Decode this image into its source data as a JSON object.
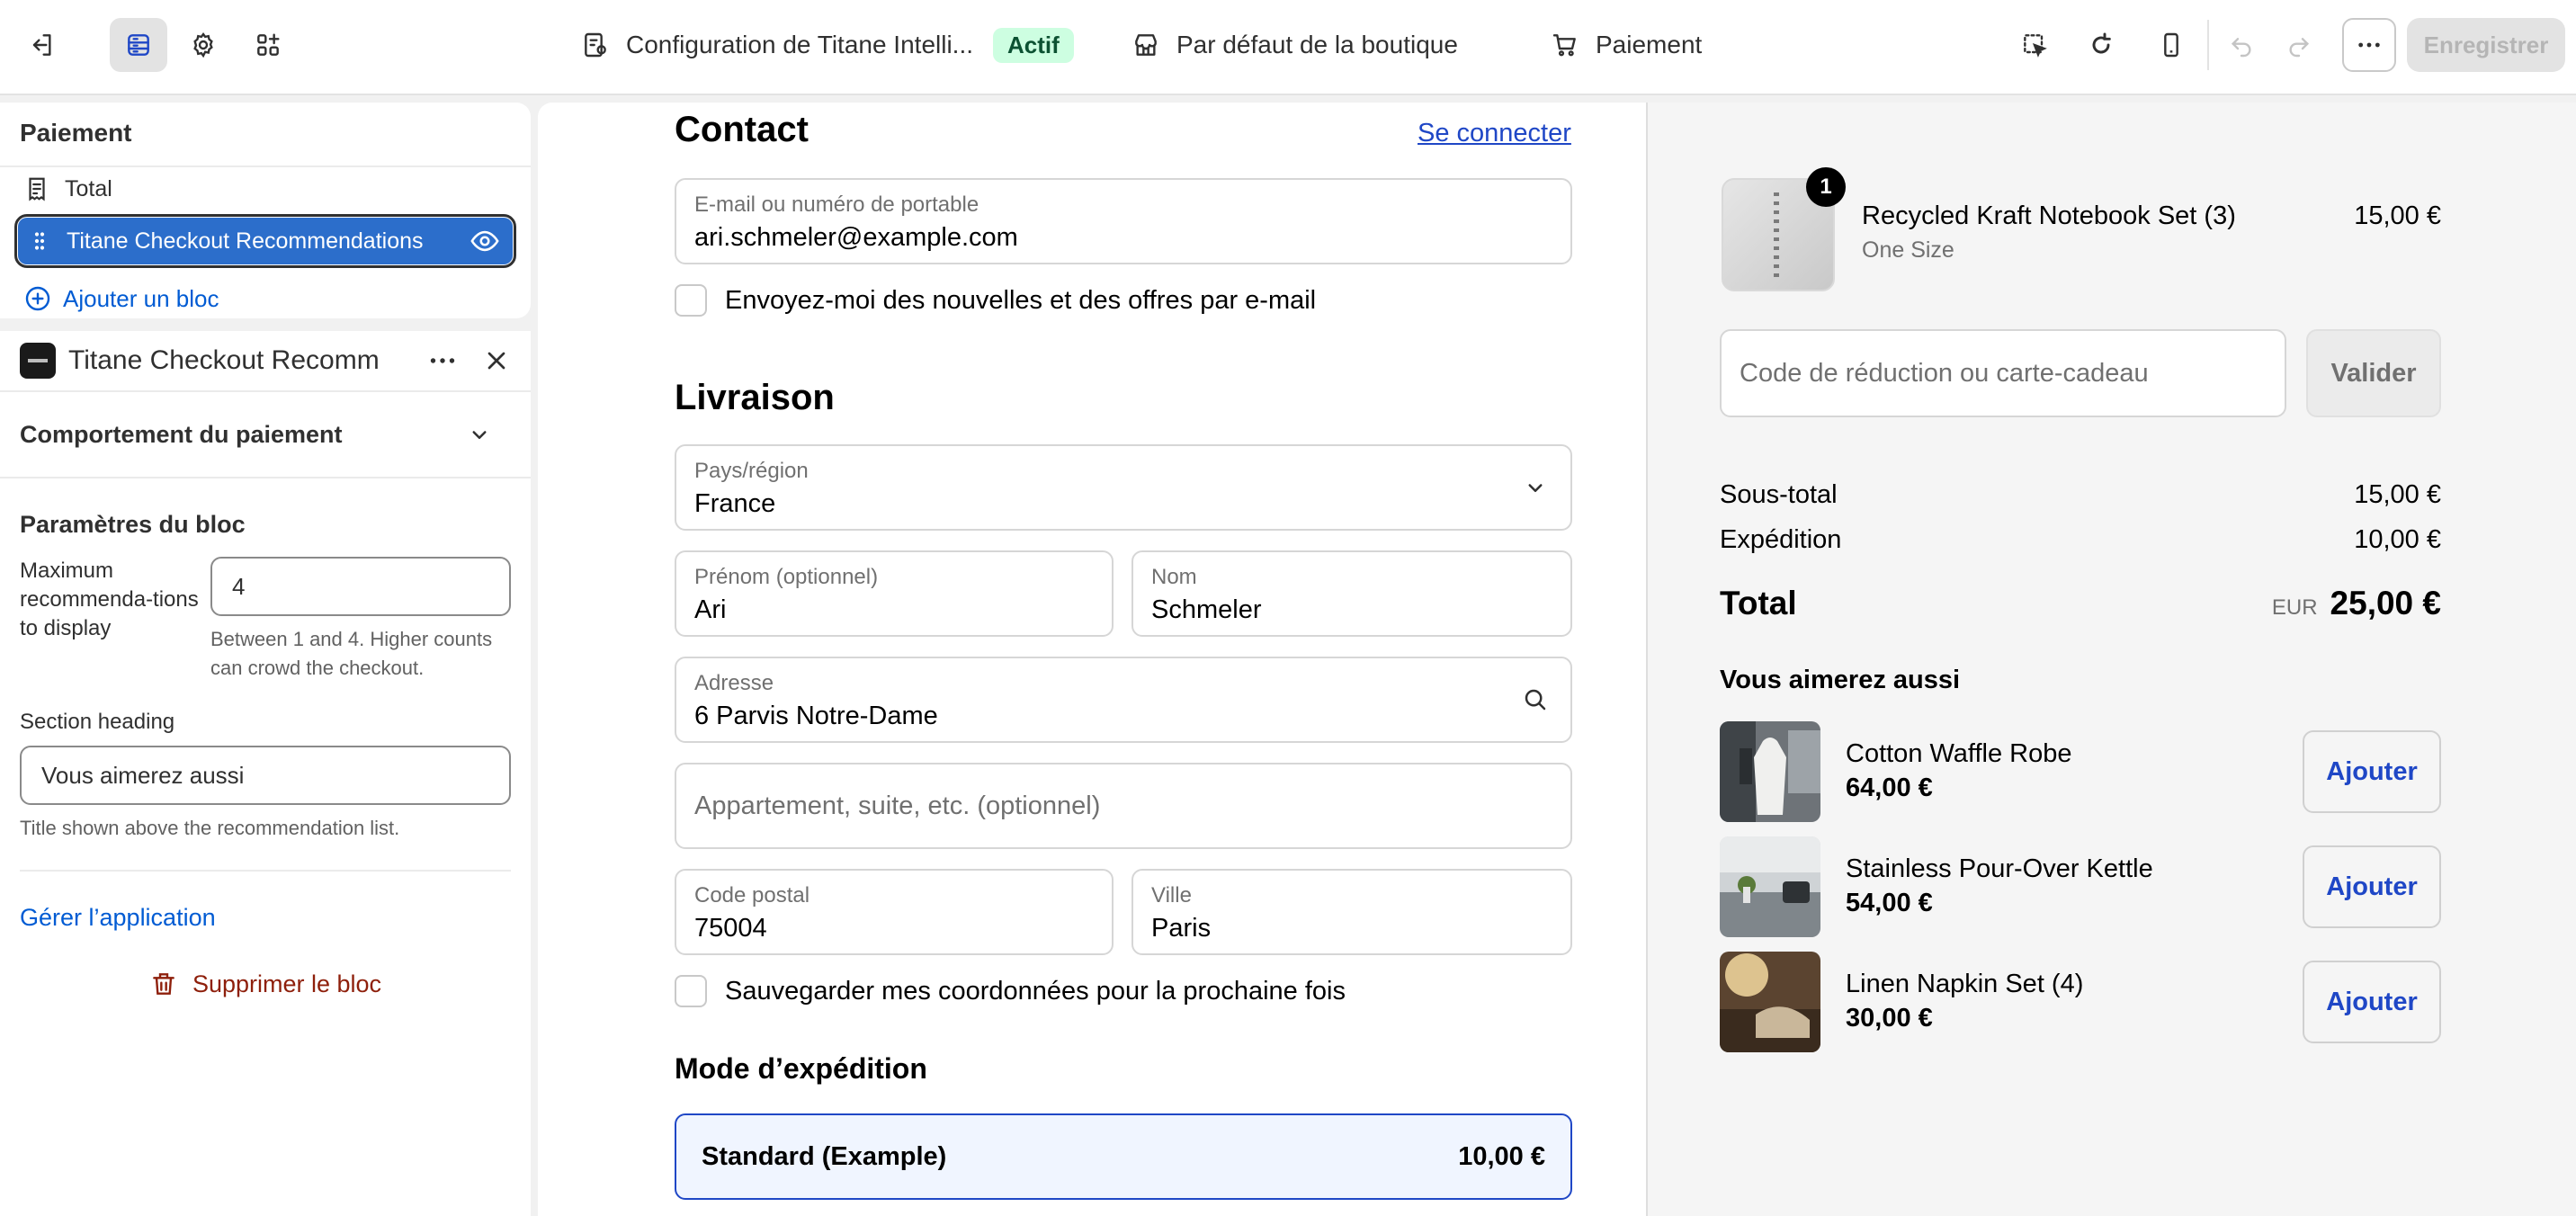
{
  "topbar": {
    "app_title": "Configuration de Titane Intelli...",
    "status_badge": "Actif",
    "store_context": "Par défaut de la boutique",
    "page_context": "Paiement",
    "save_label": "Enregistrer"
  },
  "sections": {
    "title": "Paiement",
    "items": [
      {
        "label": "Total",
        "icon": "receipt-icon"
      },
      {
        "label": "Titane Checkout Recommendations",
        "icon": "drag-handle-icon",
        "selected": true
      }
    ],
    "add_block": "Ajouter un bloc"
  },
  "settings": {
    "title": "Titane Checkout Recomm",
    "behavior": "Comportement du paiement",
    "block_params": "Paramètres du bloc",
    "max_label": "Maximum recommenda-tions to display",
    "max_value": "4",
    "max_help": "Between 1 and 4. Higher counts can crowd the checkout.",
    "heading_label": "Section heading",
    "heading_value": "Vous aimerez aussi",
    "heading_help": "Title shown above the recommendation list.",
    "manage_app": "Gérer l’application",
    "delete_block": "Supprimer le bloc"
  },
  "checkout": {
    "contact_title": "Contact",
    "login_link": "Se connecter",
    "email_label": "E-mail ou numéro de portable",
    "email_value": "ari.schmeler@example.com",
    "newsletter": "Envoyez-moi des nouvelles et des offres par e-mail",
    "delivery_title": "Livraison",
    "country_label": "Pays/région",
    "country_value": "France",
    "firstname_label": "Prénom (optionnel)",
    "firstname_value": "Ari",
    "lastname_label": "Nom",
    "lastname_value": "Schmeler",
    "address_label": "Adresse",
    "address_value": "6 Parvis Notre-Dame",
    "apartment_placeholder": "Appartement, suite, etc. (optionnel)",
    "postal_label": "Code postal",
    "postal_value": "75004",
    "city_label": "Ville",
    "city_value": "Paris",
    "save_info": "Sauvegarder mes coordonnées pour la prochaine fois",
    "shipping_title": "Mode d’expédition",
    "shipping_name": "Standard (Example)",
    "shipping_price": "10,00 €"
  },
  "summary": {
    "product_name": "Recycled Kraft Notebook Set (3)",
    "product_variant": "One Size",
    "product_price": "15,00 €",
    "product_qty": "1",
    "discount_placeholder": "Code de réduction ou carte-cadeau",
    "validate": "Valider",
    "subtotal_label": "Sous-total",
    "subtotal_value": "15,00 €",
    "shipping_label": "Expédition",
    "shipping_value": "10,00 €",
    "total_label": "Total",
    "currency": "EUR",
    "total_value": "25,00 €",
    "rec_title": "Vous aimerez aussi",
    "recommendations": [
      {
        "name": "Cotton Waffle Robe",
        "price": "64,00 €",
        "button": "Ajouter"
      },
      {
        "name": "Stainless Pour-Over Kettle",
        "price": "54,00 €",
        "button": "Ajouter"
      },
      {
        "name": "Linen Napkin Set (4)",
        "price": "30,00 €",
        "button": "Ajouter"
      }
    ]
  },
  "colors": {
    "accent_blue": "#2c6ecb",
    "link_blue": "#1f47c6",
    "success_bg": "#cdfee1",
    "danger": "#8e1f0b"
  }
}
